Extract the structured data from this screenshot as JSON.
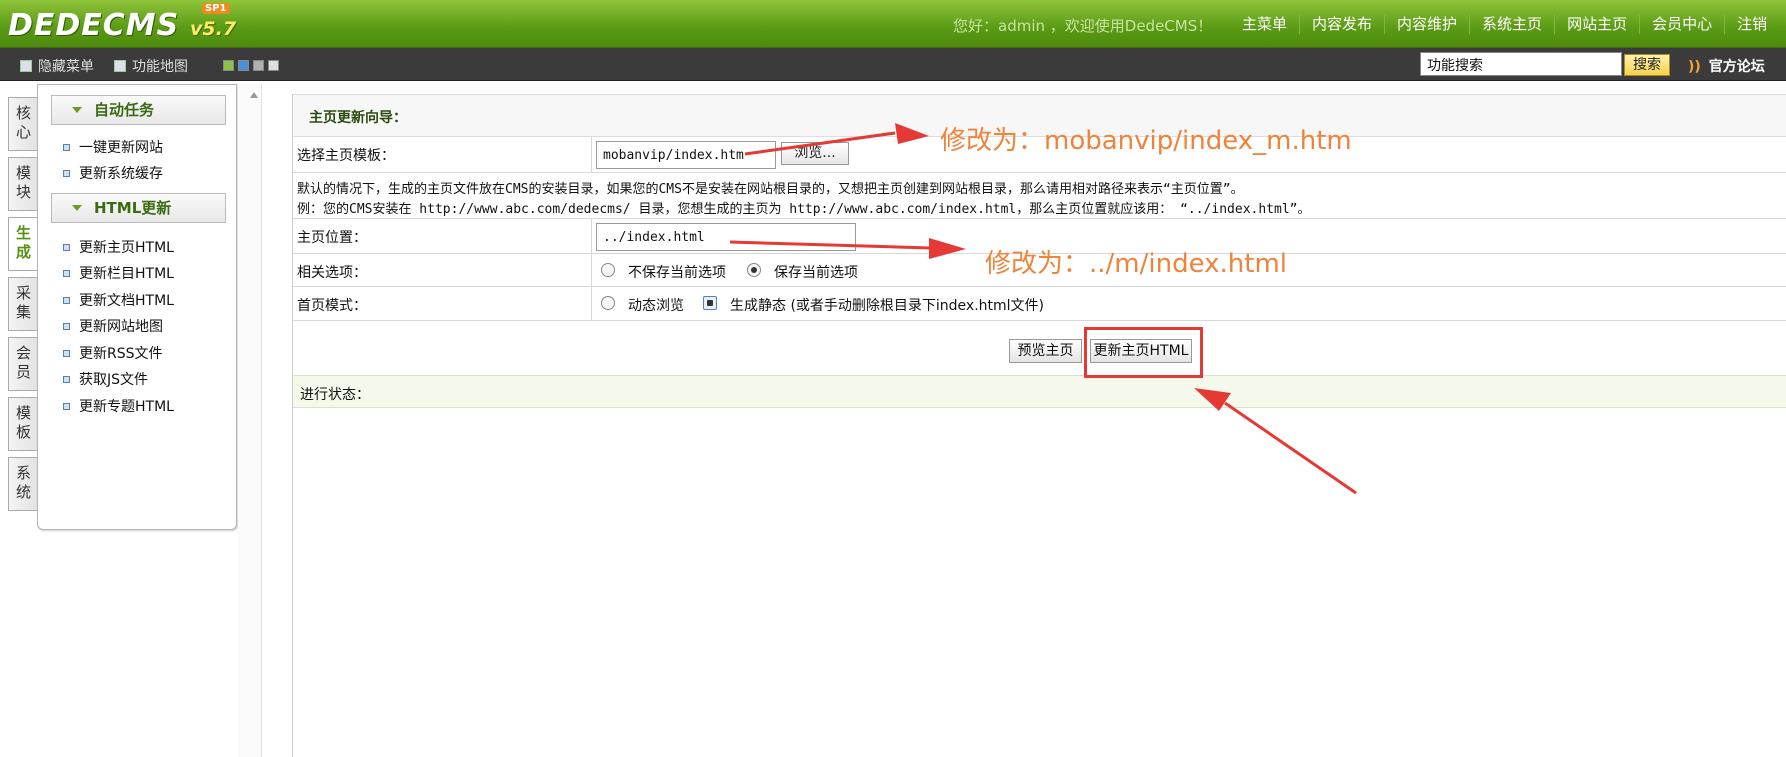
{
  "header": {
    "logo_text": "DEDECMS",
    "logo_version": "v5.7",
    "logo_badge": "SP1",
    "greeting": "您好：admin ，欢迎使用DedeCMS！",
    "nav": [
      "主菜单",
      "内容发布",
      "内容维护",
      "系统主页",
      "网站主页",
      "会员中心",
      "注销"
    ]
  },
  "toolbar": {
    "hide_menu": "隐藏菜单",
    "function_map": "功能地图",
    "search_value": "功能搜索",
    "search_button": "搜索",
    "forum": "官方论坛",
    "swatch_colors": [
      "#8bc34a",
      "#4a90d9",
      "#b0b0b0",
      "#e0e0e0"
    ]
  },
  "left_tabs": [
    "核心",
    "模块",
    "生成",
    "采集",
    "会员",
    "模板",
    "系统"
  ],
  "menu": {
    "group1": {
      "title": "自动任务",
      "items": [
        "一键更新网站",
        "更新系统缓存"
      ]
    },
    "group2": {
      "title": "HTML更新",
      "items": [
        "更新主页HTML",
        "更新栏目HTML",
        "更新文档HTML",
        "更新网站地图",
        "更新RSS文件",
        "获取JS文件",
        "更新专题HTML"
      ]
    }
  },
  "main": {
    "title": "主页更新向导：",
    "template_label": "选择主页模板：",
    "template_value": "mobanvip/index.htm",
    "browse_button": "浏览...",
    "note_line1": "默认的情况下，生成的主页文件放在CMS的安装目录，如果您的CMS不是安装在网站根目录的，又想把主页创建到网站根目录，那么请用相对路径来表示“主页位置”。",
    "note_line2": "例：您的CMS安装在 http://www.abc.com/dedecms/ 目录，您想生成的主页为 http://www.abc.com/index.html，那么主页位置就应该用： “../index.html”。",
    "position_label": "主页位置：",
    "position_value": "../index.html",
    "options_label": "相关选项：",
    "option_nosave": "不保存当前选项",
    "option_save": "保存当前选项",
    "mode_label": "首页模式：",
    "mode_dynamic": "动态浏览",
    "mode_static": "生成静态 (或者手动删除根目录下index.html文件)",
    "preview_button": "预览主页",
    "update_button": "更新主页HTML",
    "status_label": "进行状态："
  },
  "annotations": {
    "template_note": "修改为：mobanvip/index_m.htm",
    "position_note": "修改为：../m/index.html"
  },
  "colors": {
    "brand_green": "#5a9a14",
    "annotation_orange": "#f0823a",
    "highlight_red": "#e53935"
  }
}
